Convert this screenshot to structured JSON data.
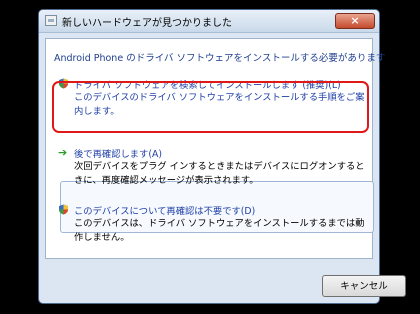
{
  "window": {
    "title": "新しいハードウェアが見つかりました",
    "close_label": "×"
  },
  "content": {
    "header": "Android Phone のドライバ ソフトウェアをインストールする必要があります"
  },
  "options": [
    {
      "title": "ドライバ ソフトウェアを検索してインストールします (推奨)(L)",
      "description": "このデバイスのドライバ ソフトウェアをインストールする手順をご案内します。"
    },
    {
      "title": "後で再確認します(A)",
      "description": "次回デバイスをプラグ インするときまたはデバイスにログオンするときに、再度確認メッセージが表示されます。"
    },
    {
      "title": "このデバイスについて再確認は不要です(D)",
      "description": "このデバイスは、ドライバ ソフトウェアをインストールするまでは動作しません。"
    }
  ],
  "buttons": {
    "cancel_label": "キャンセル"
  },
  "colors": {
    "link_blue": "#1f3fa8",
    "highlight_red": "#e01818",
    "arrow_green": "#2e9a2e"
  }
}
